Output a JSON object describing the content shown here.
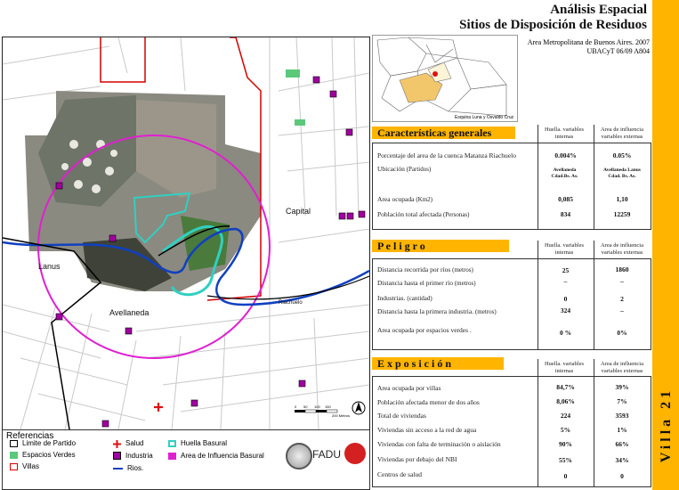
{
  "header": {
    "title_line1": "Análisis Espacial",
    "title_line2": "Sitios de Disposición de Residuos",
    "subtitle_line1": "Area Metropolitana de Buenos Aires. 2007",
    "subtitle_line2": "UBACyT 06/09  A804"
  },
  "locator_map": {
    "caption": "Esquina Luna y Osvaldo Cruz",
    "highlight_color": "#f2c76b",
    "point_color": "#e01010"
  },
  "sidebar": {
    "label": "Villa 21",
    "color": "#ffb400"
  },
  "map": {
    "labels": {
      "capital": "Capital",
      "lanus": "Lanus",
      "avellaneda": "Avellaneda",
      "riachuelo": "Riachuelo"
    },
    "scale_ticks": [
      "0",
      "50",
      "100",
      "150",
      "200 Metros"
    ],
    "colors": {
      "villas": "#d40000",
      "influencia": "#e020d0",
      "huella": "#30d0c0",
      "rios": "#1040c0",
      "industria": "#a000a0",
      "espacios_verdes": "#5cc87a",
      "partido": "#000000"
    }
  },
  "legend": {
    "title": "Referencias",
    "items": {
      "limite": "Limite de Partido",
      "espacios": "Espacios Verdes",
      "villas": "Villas",
      "salud": "Salud",
      "industria": "Industria",
      "rios": "Rios.",
      "huella": "Huella Basural",
      "influencia": "Area de Influencia Basural"
    },
    "logo_text": "FADU"
  },
  "sections": {
    "caracteristicas": {
      "title": "Características      generales",
      "col1": "Huella. variables internas",
      "col2": "Area de influencia variables externas",
      "rows": [
        {
          "label": "Porcentaje del area de la cuenca Matanza Riachuelo",
          "unit": "",
          "v1": "0.004%",
          "v2": "0.05%"
        },
        {
          "label": "Ubicación",
          "unit": "(Partidos)",
          "v1": "Avellaneda Cdad.Bs. As.",
          "v2": "Avellaneda Lanus Cdad. Bs. As."
        },
        {
          "label": "Area ocupada",
          "unit": "(Km2)",
          "v1": "0,085",
          "v2": "1,10"
        },
        {
          "label": "Población total afectada",
          "unit": "(Personas)",
          "v1": "834",
          "v2": "12259"
        }
      ]
    },
    "peligro": {
      "title": "P e l i g r o",
      "col1": "Huella. variables internas",
      "col2": "Area de influencia variables externas",
      "rows": [
        {
          "label": "Distancia recorrida por ríos",
          "unit": "(metros)",
          "v1": "25",
          "v2": "1860"
        },
        {
          "label": "Distancia hasta el primer río",
          "unit": "(metros)",
          "v1": "–",
          "v2": "–"
        },
        {
          "label": "Industrias.",
          "unit": "(cantidad)",
          "v1": "0",
          "v2": "2"
        },
        {
          "label": "Distancia hasta la primera industria.",
          "unit": "(metros)",
          "v1": "324",
          "v2": "–"
        },
        {
          "label": "Area ocupada por espacios verdes .",
          "unit": "",
          "v1": "0 %",
          "v2": "0%"
        }
      ]
    },
    "exposicion": {
      "title": "E x p o s i c i ó n",
      "col1": "Huella. variables internas",
      "col2": "Area de influencia variables externas",
      "rows": [
        {
          "label": "Area ocupada por villas",
          "v1": "84,7%",
          "v2": "39%"
        },
        {
          "label": "Población afectada menor de dos años",
          "v1": "8,06%",
          "v2": "7%"
        },
        {
          "label": "Total de viviendas",
          "v1": "224",
          "v2": "3593"
        },
        {
          "label": "Viviendas sin acceso a la red de agua",
          "v1": "5%",
          "v2": "1%"
        },
        {
          "label": "Viviendas con falta de terminación  o aislación",
          "v1": "90%",
          "v2": "66%"
        },
        {
          "label": "Viviendas por debajo del NBI",
          "v1": "55%",
          "v2": "34%"
        },
        {
          "label": "Centros de salud",
          "v1": "0",
          "v2": "0"
        }
      ]
    }
  }
}
